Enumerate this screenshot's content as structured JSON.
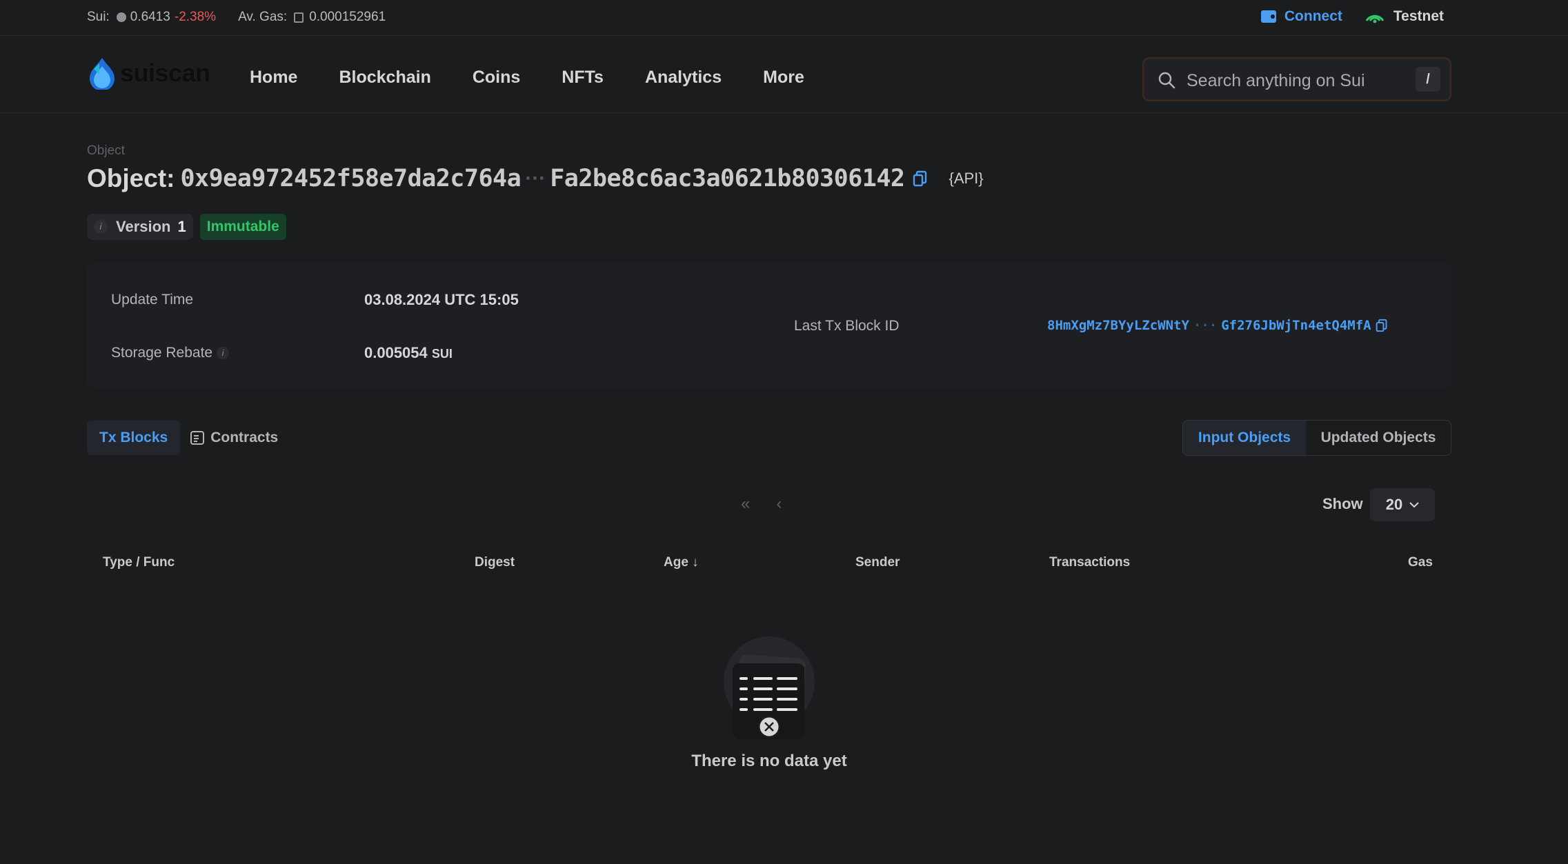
{
  "ticker": {
    "sui_label": "Sui:",
    "sui_price": "0.6413",
    "sui_change": "-2.38%",
    "gas_label": "Av. Gas:",
    "gas_value": "0.000152961",
    "connect": "Connect",
    "network": "Testnet"
  },
  "nav": {
    "logo_text": "suiscan",
    "links": [
      "Home",
      "Blockchain",
      "Coins",
      "NFTs",
      "Analytics",
      "More"
    ],
    "search_placeholder": "Search anything on Sui",
    "search_shortcut": "/"
  },
  "object": {
    "breadcrumb": "Object",
    "title_prefix": "Object:",
    "id_start": "0x9ea972452f58e7da2c764a",
    "id_sep": "···",
    "id_end": "Fa2be8c6ac3a0621b80306142",
    "api_label": "{API}",
    "version_label": "Version",
    "version_value": "1",
    "status_badge": "Immutable"
  },
  "details": {
    "update_time_label": "Update Time",
    "update_time_value": "03.08.2024 UTC 15:05",
    "storage_rebate_label": "Storage Rebate",
    "storage_rebate_value": "0.005054",
    "storage_rebate_unit": "SUI",
    "last_block_label": "Last Tx Block ID",
    "last_block_start": "8HmXgMz7BYyLZcWNtY",
    "last_block_sep": "···",
    "last_block_end": "Gf276JbWjTn4etQ4MfA"
  },
  "tabs": {
    "tx_blocks": "Tx Blocks",
    "contracts": "Contracts",
    "input_objects": "Input Objects",
    "updated_objects": "Updated Objects"
  },
  "table": {
    "pager_first": "«",
    "pager_prev": "‹",
    "show_label": "Show",
    "show_value": "20",
    "columns": [
      "Type / Func",
      "Digest",
      "Age ↓",
      "Sender",
      "Transactions",
      "Gas"
    ],
    "empty_message": "There is no data yet"
  },
  "colors": {
    "accent": "#4a9ef4",
    "negative": "#f0555a",
    "success": "#35c46a",
    "background": "#1b1c1e"
  }
}
